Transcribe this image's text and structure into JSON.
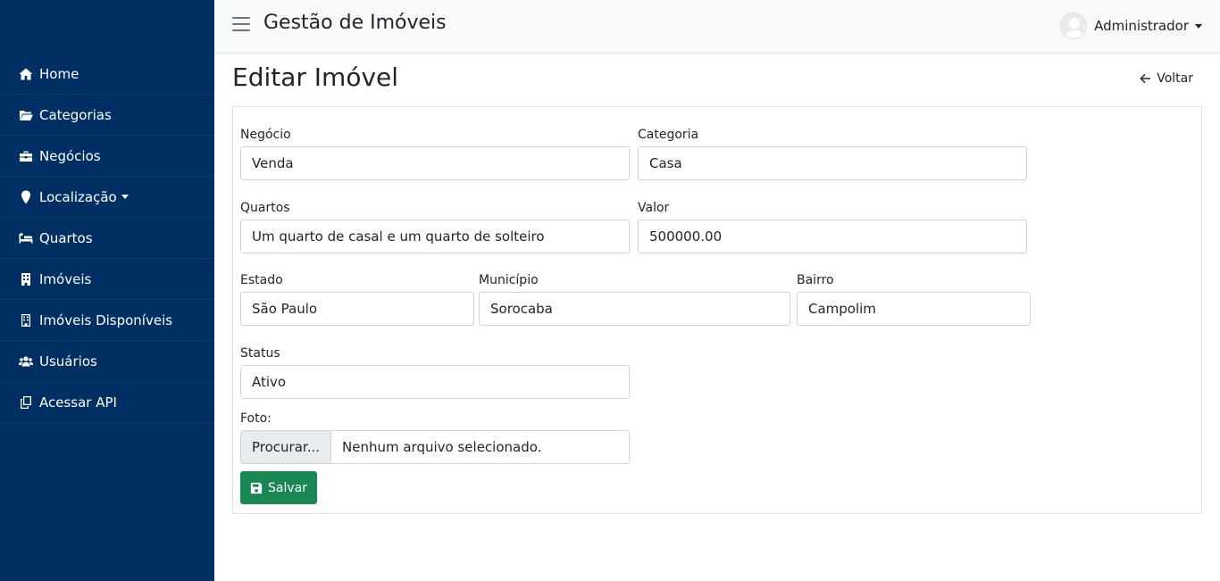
{
  "app": {
    "title": "Gestão de Imóveis"
  },
  "user": {
    "name": "Administrador"
  },
  "sidebar": {
    "items": [
      {
        "label": "Home",
        "icon": "home-icon"
      },
      {
        "label": "Categorias",
        "icon": "folder-open-icon"
      },
      {
        "label": "Negócios",
        "icon": "briefcase-icon"
      },
      {
        "label": "Localização",
        "icon": "map-marker-icon"
      },
      {
        "label": "Quartos",
        "icon": "bed-icon"
      },
      {
        "label": "Imóveis",
        "icon": "building-icon"
      },
      {
        "label": "Imóveis Disponíveis",
        "icon": "building-outline-icon"
      },
      {
        "label": "Usuários",
        "icon": "users-icon"
      },
      {
        "label": "Acessar API",
        "icon": "copy-icon"
      }
    ]
  },
  "page": {
    "title": "Editar Imóvel",
    "back_label": "Voltar"
  },
  "form": {
    "negocio": {
      "label": "Negócio",
      "value": "Venda"
    },
    "categoria": {
      "label": "Categoria",
      "value": "Casa"
    },
    "quartos": {
      "label": "Quartos",
      "value": "Um quarto de casal e um quarto de solteiro"
    },
    "valor": {
      "label": "Valor",
      "value": "500000.00"
    },
    "estado": {
      "label": "Estado",
      "value": "São Paulo"
    },
    "municipio": {
      "label": "Município",
      "value": "Sorocaba"
    },
    "bairro": {
      "label": "Bairro",
      "value": "Campolim"
    },
    "status": {
      "label": "Status",
      "value": "Ativo"
    },
    "foto": {
      "label": "Foto:",
      "button": "Procurar...",
      "file_text": "Nenhum arquivo selecionado."
    },
    "save_label": "Salvar"
  },
  "colors": {
    "sidebar": "#002f63",
    "topbar": "#f8f9fa",
    "save_button": "#198754"
  }
}
